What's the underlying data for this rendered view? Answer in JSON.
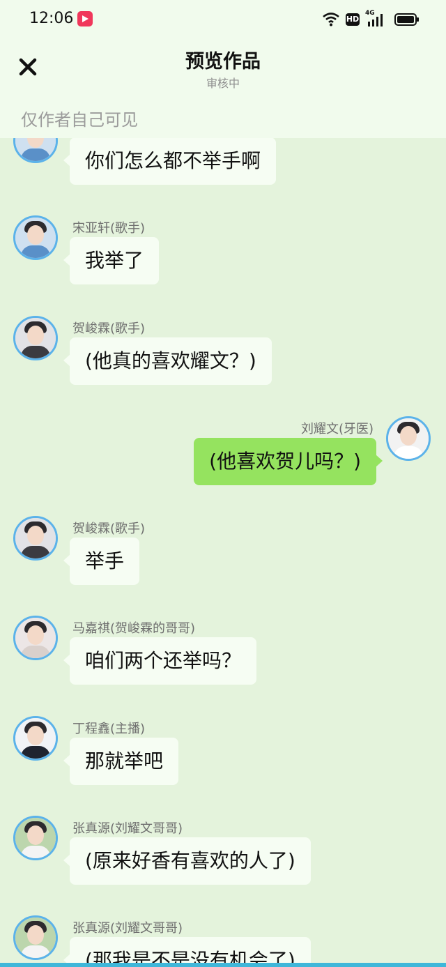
{
  "status_bar": {
    "time": "12:06",
    "hd": "HD",
    "network": "4G",
    "icons": [
      "video-app-icon",
      "wifi-icon",
      "hd-icon",
      "signal-icon",
      "battery-icon"
    ]
  },
  "header": {
    "title": "预览作品",
    "subtitle": "审核中",
    "visibility_note": "仅作者自己可见"
  },
  "messages": [
    {
      "side": "left",
      "name": "",
      "text": "你们怎么都不举手啊",
      "avatar_color": "#9cc4e6"
    },
    {
      "side": "left",
      "name": "宋亚轩(歌手)",
      "text": "我举了",
      "avatar_color": "#9cc4e6"
    },
    {
      "side": "left",
      "name": "贺峻霖(歌手)",
      "text": "(他真的喜欢耀文？)",
      "avatar_color": "#d8d8dc"
    },
    {
      "side": "right",
      "name": "刘耀文(牙医)",
      "text": "(他喜欢贺儿吗？)",
      "avatar_color": "#eeeeee"
    },
    {
      "side": "left",
      "name": "贺峻霖(歌手)",
      "text": "举手",
      "avatar_color": "#d8d8dc"
    },
    {
      "side": "left",
      "name": "马嘉祺(贺峻霖的哥哥)",
      "text": "咱们两个还举吗？",
      "avatar_color": "#e6e0e0"
    },
    {
      "side": "left",
      "name": "丁程鑫(主播)",
      "text": "那就举吧",
      "avatar_color": "#eef0f4"
    },
    {
      "side": "left",
      "name": "张真源(刘耀文哥哥)",
      "text": "(原来好香有喜欢的人了)",
      "avatar_color": "#b7d2a8"
    },
    {
      "side": "left",
      "name": "张真源(刘耀文哥哥)",
      "text": "(那我是不是没有机会了)",
      "avatar_color": "#b7d2a8"
    }
  ],
  "colors": {
    "background": "#e4f3dc",
    "header_bg": "#f1fbed",
    "bubble_left": "#f6fdf3",
    "bubble_right": "#95e35f",
    "avatar_ring": "#5bb2ea"
  }
}
